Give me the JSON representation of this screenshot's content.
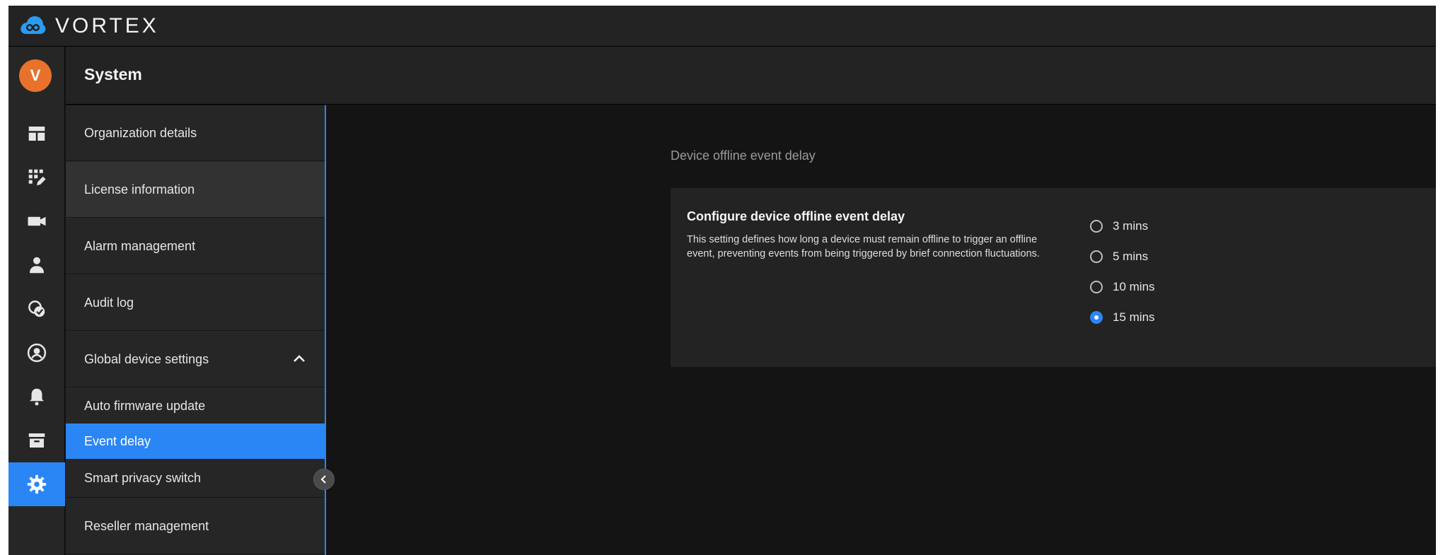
{
  "brand": {
    "name": "VORTEX",
    "logo_icon": "cloud-logo-icon",
    "accent": "#2b9bf0"
  },
  "user": {
    "initial": "V",
    "avatar_color": "#e8722c"
  },
  "rail": {
    "items": [
      {
        "icon": "dashboard-icon"
      },
      {
        "icon": "apps-edit-icon"
      },
      {
        "icon": "camera-icon"
      },
      {
        "icon": "person-icon"
      },
      {
        "icon": "tag-icon"
      },
      {
        "icon": "account-circle-icon"
      },
      {
        "icon": "bell-icon"
      },
      {
        "icon": "archive-icon"
      },
      {
        "icon": "gear-icon",
        "active": true
      }
    ]
  },
  "header": {
    "title": "System"
  },
  "subnav": {
    "items": [
      {
        "label": "Organization details"
      },
      {
        "label": "License information"
      },
      {
        "label": "Alarm management"
      },
      {
        "label": "Audit log"
      },
      {
        "label": "Global device settings",
        "expanded": true
      }
    ],
    "subitems": [
      {
        "label": "Auto firmware update"
      },
      {
        "label": "Event delay",
        "active": true
      },
      {
        "label": "Smart privacy switch"
      }
    ],
    "bottom_item": {
      "label": "Reseller management"
    }
  },
  "main": {
    "section_label": "Device offline event delay",
    "card": {
      "title": "Configure device offline event delay",
      "description": "This setting defines how long a device must remain offline to trigger an offline event, preventing events from being triggered by brief connection fluctuations.",
      "options": [
        {
          "label": "3 mins",
          "selected": false
        },
        {
          "label": "5 mins",
          "selected": false
        },
        {
          "label": "10 mins",
          "selected": false
        },
        {
          "label": "15 mins",
          "selected": true
        }
      ]
    }
  },
  "colors": {
    "accent_blue": "#2b86f5",
    "background": "#141414",
    "panel": "#232323"
  }
}
